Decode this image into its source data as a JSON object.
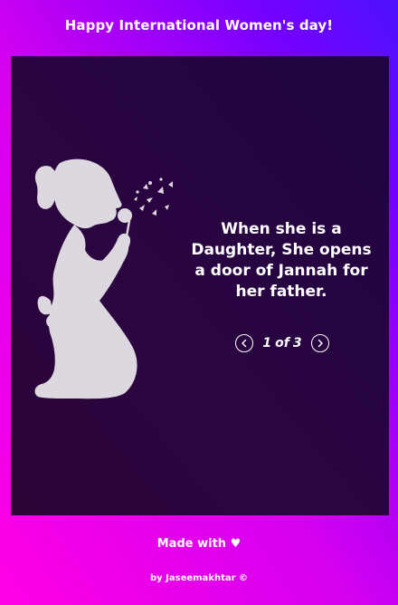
{
  "header": {
    "title": "Happy International Women's day!"
  },
  "slide": {
    "image_icon": "girl-blowing-dandelion-silhouette",
    "quote": "When she is a Daughter, She opens a door of Jannah for her father.",
    "pager": {
      "current": "1",
      "of_label": "of",
      "total": "3",
      "prev_icon": "chevron-left-circle-icon",
      "next_icon": "chevron-right-circle-icon"
    }
  },
  "footer": {
    "made_with": "Made with ♥",
    "credit": "by Jaseemakhtar ©"
  },
  "colors": {
    "background_start": "#ff00e6",
    "background_end": "#4d12ff",
    "card": "#2a0436",
    "silhouette": "#ddd8e0"
  }
}
